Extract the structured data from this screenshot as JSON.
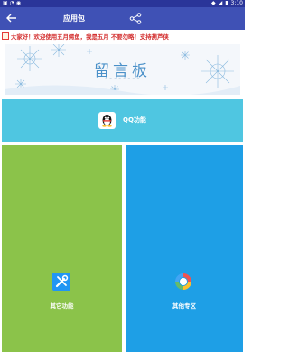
{
  "status_bar": {
    "left_icons": [
      "notification-icon",
      "wifi-icon",
      "android-icon"
    ],
    "right_icons": [
      "location-icon",
      "signal-icon",
      "battery-icon"
    ],
    "time": "3:10"
  },
  "app_bar": {
    "title": "应用包",
    "back_icon": "back-arrow-icon",
    "share_icon": "share-icon",
    "color": "#3f51b5"
  },
  "marquee": {
    "icon": "speaker-icon",
    "text": "大家好！欢迎使用五月鳄鱼，我是五月 不要勿略！支持葫芦侠"
  },
  "banner": {
    "title": "留言板"
  },
  "qq_tile": {
    "icon": "qq-penguin-icon",
    "label": "QQ功能",
    "color": "#4fc6e1"
  },
  "other_tile": {
    "icon": "tools-icon",
    "label": "其它功能",
    "color": "#8bc34a"
  },
  "zone_tile": {
    "icon": "ring-icon",
    "label": "其他专区",
    "color": "#1e9fe6"
  }
}
